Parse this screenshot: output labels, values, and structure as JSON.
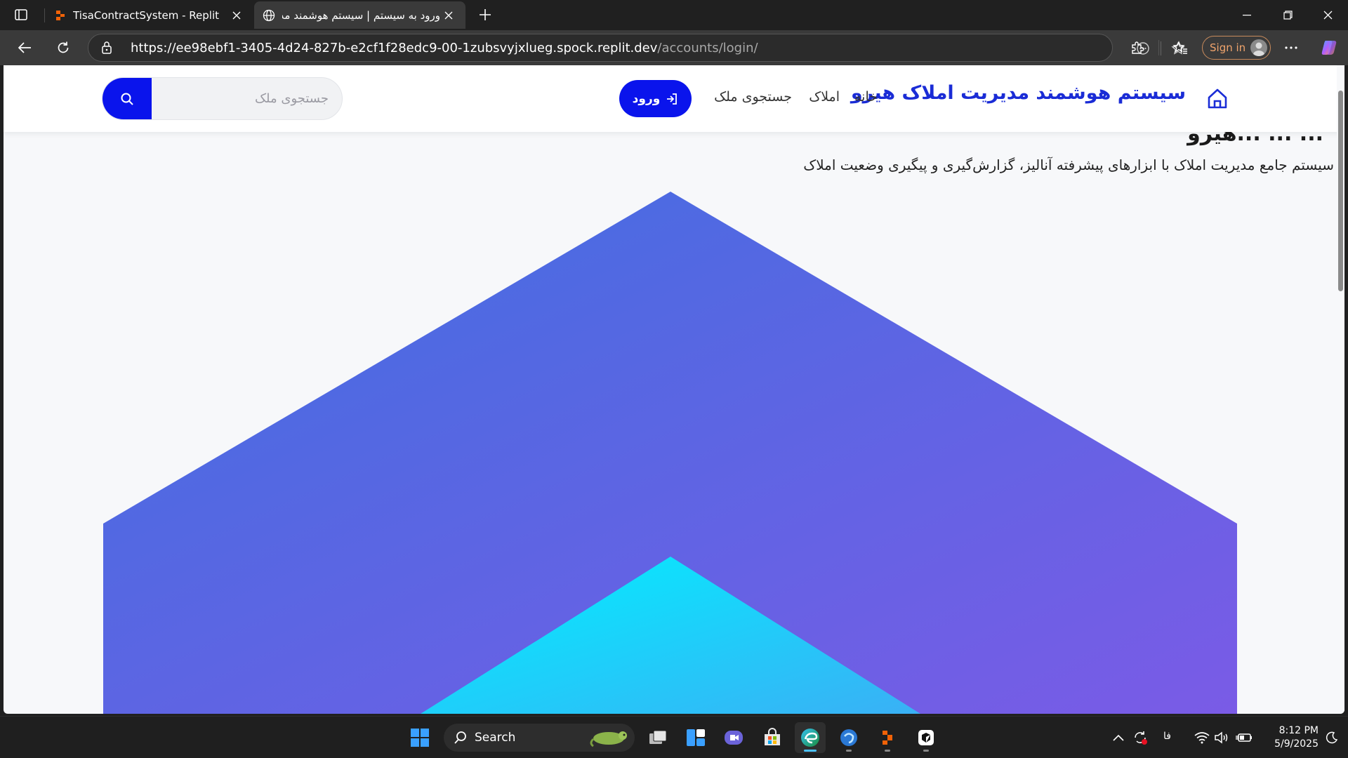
{
  "browser": {
    "tabs": [
      {
        "title": "TisaContractSystem - Replit",
        "active": false
      },
      {
        "title": "ورود به سیستم | سیستم هوشمند مد",
        "active": true
      }
    ],
    "url_host": "https://ee98ebf1-3405-4d24-827b-e2cf1f28edc9-00-1zubsvyjxlueg.spock.replit.dev",
    "url_path": "/accounts/login/",
    "signin_label": "Sign in",
    "colors": {
      "chrome": "#202020",
      "toolbar": "#3a3a3a",
      "signin_accent": "#f0a46c"
    }
  },
  "site": {
    "brand": "سیستم هوشمند مدیریت املاک هیرو",
    "nav": {
      "home": "خانه",
      "properties": "املاک",
      "search": "جستجوی ملک"
    },
    "login_label": "ورود",
    "search_placeholder": "جستجوی ملک",
    "hero": {
      "title_fragment": "... ... ...هیرو",
      "description": "سیستم جامع مدیریت املاک با ابزارهای پیشرفته آنالیز، گزارش‌گیری و پیگیری وضعیت املاک"
    },
    "colors": {
      "primary": "#0a14ec",
      "brand_text": "#1a2cd6",
      "hero_grad_start": "#3f6fe0",
      "hero_grad_end": "#7a5be6",
      "inner_grad_start": "#00f0ff",
      "inner_grad_end": "#3ab0f5"
    }
  },
  "taskbar": {
    "search_label": "Search",
    "language": "فا",
    "time": "8:12 PM",
    "date": "5/9/2025",
    "apps": [
      "start-icon",
      "task-view-icon",
      "widgets-icon",
      "teams-icon",
      "store-icon",
      "edge-icon",
      "browser-icon",
      "replit-icon",
      "app-icon"
    ]
  }
}
